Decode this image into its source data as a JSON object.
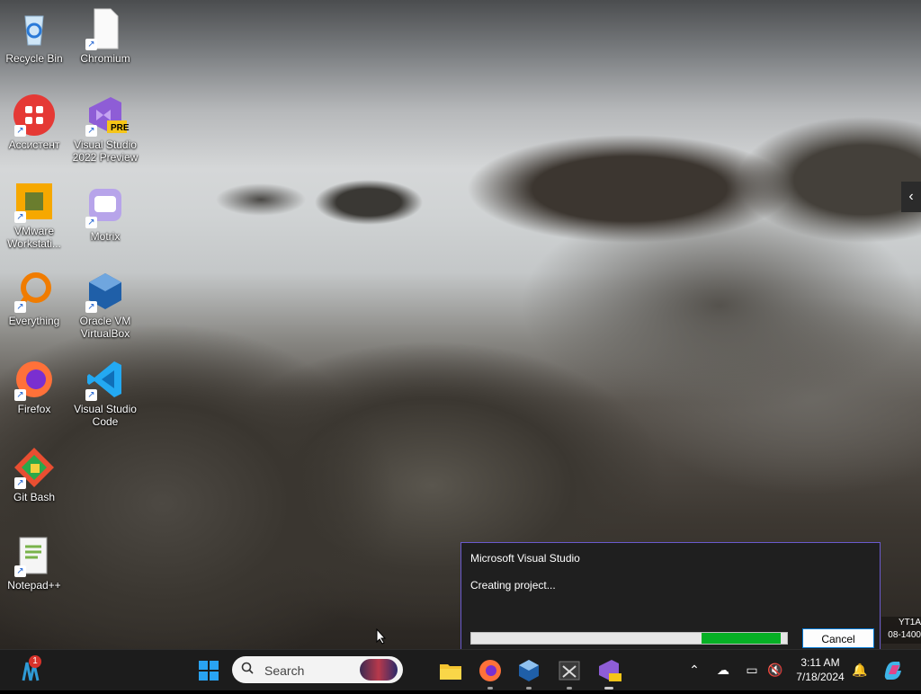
{
  "desktop": {
    "icons": [
      {
        "label": "Recycle Bin",
        "icon": "recycle-bin-icon"
      },
      {
        "label": "Chromium",
        "icon": "file-icon"
      },
      {
        "label": "Ассистент",
        "icon": "assistant-icon"
      },
      {
        "label": "Visual Studio 2022 Preview",
        "icon": "visual-studio-preview-icon",
        "badge": "PRE"
      },
      {
        "label": "VMware Workstati...",
        "icon": "vmware-icon"
      },
      {
        "label": "Motrix",
        "icon": "motrix-icon"
      },
      {
        "label": "Everything",
        "icon": "everything-search-icon"
      },
      {
        "label": "Oracle VM VirtualBox",
        "icon": "virtualbox-icon"
      },
      {
        "label": "Firefox",
        "icon": "firefox-icon"
      },
      {
        "label": "Visual Studio Code",
        "icon": "vscode-icon"
      },
      {
        "label": "Git Bash",
        "icon": "git-bash-icon"
      },
      {
        "label": "Notepad++",
        "icon": "notepad-plus-plus-icon"
      }
    ]
  },
  "dialog": {
    "title": "Microsoft Visual Studio",
    "status": "Creating project...",
    "cancel_label": "Cancel",
    "progress_state": "indeterminate"
  },
  "watermark": {
    "line1": "YT1A",
    "line2": "08-1400"
  },
  "taskbar": {
    "search_placeholder": "Search",
    "notification_badge": "1",
    "clock": {
      "time": "3:11 AM",
      "date": "7/18/2024"
    },
    "pinned": [
      "file-explorer-icon",
      "firefox-icon",
      "virtualbox-icon",
      "terminal-icon",
      "visual-studio-preview-icon"
    ]
  },
  "colors": {
    "taskbar": "#1c1c1c",
    "progress": "#06b025",
    "dialog_border": "#6a5acd",
    "accent": "#0078d4"
  }
}
